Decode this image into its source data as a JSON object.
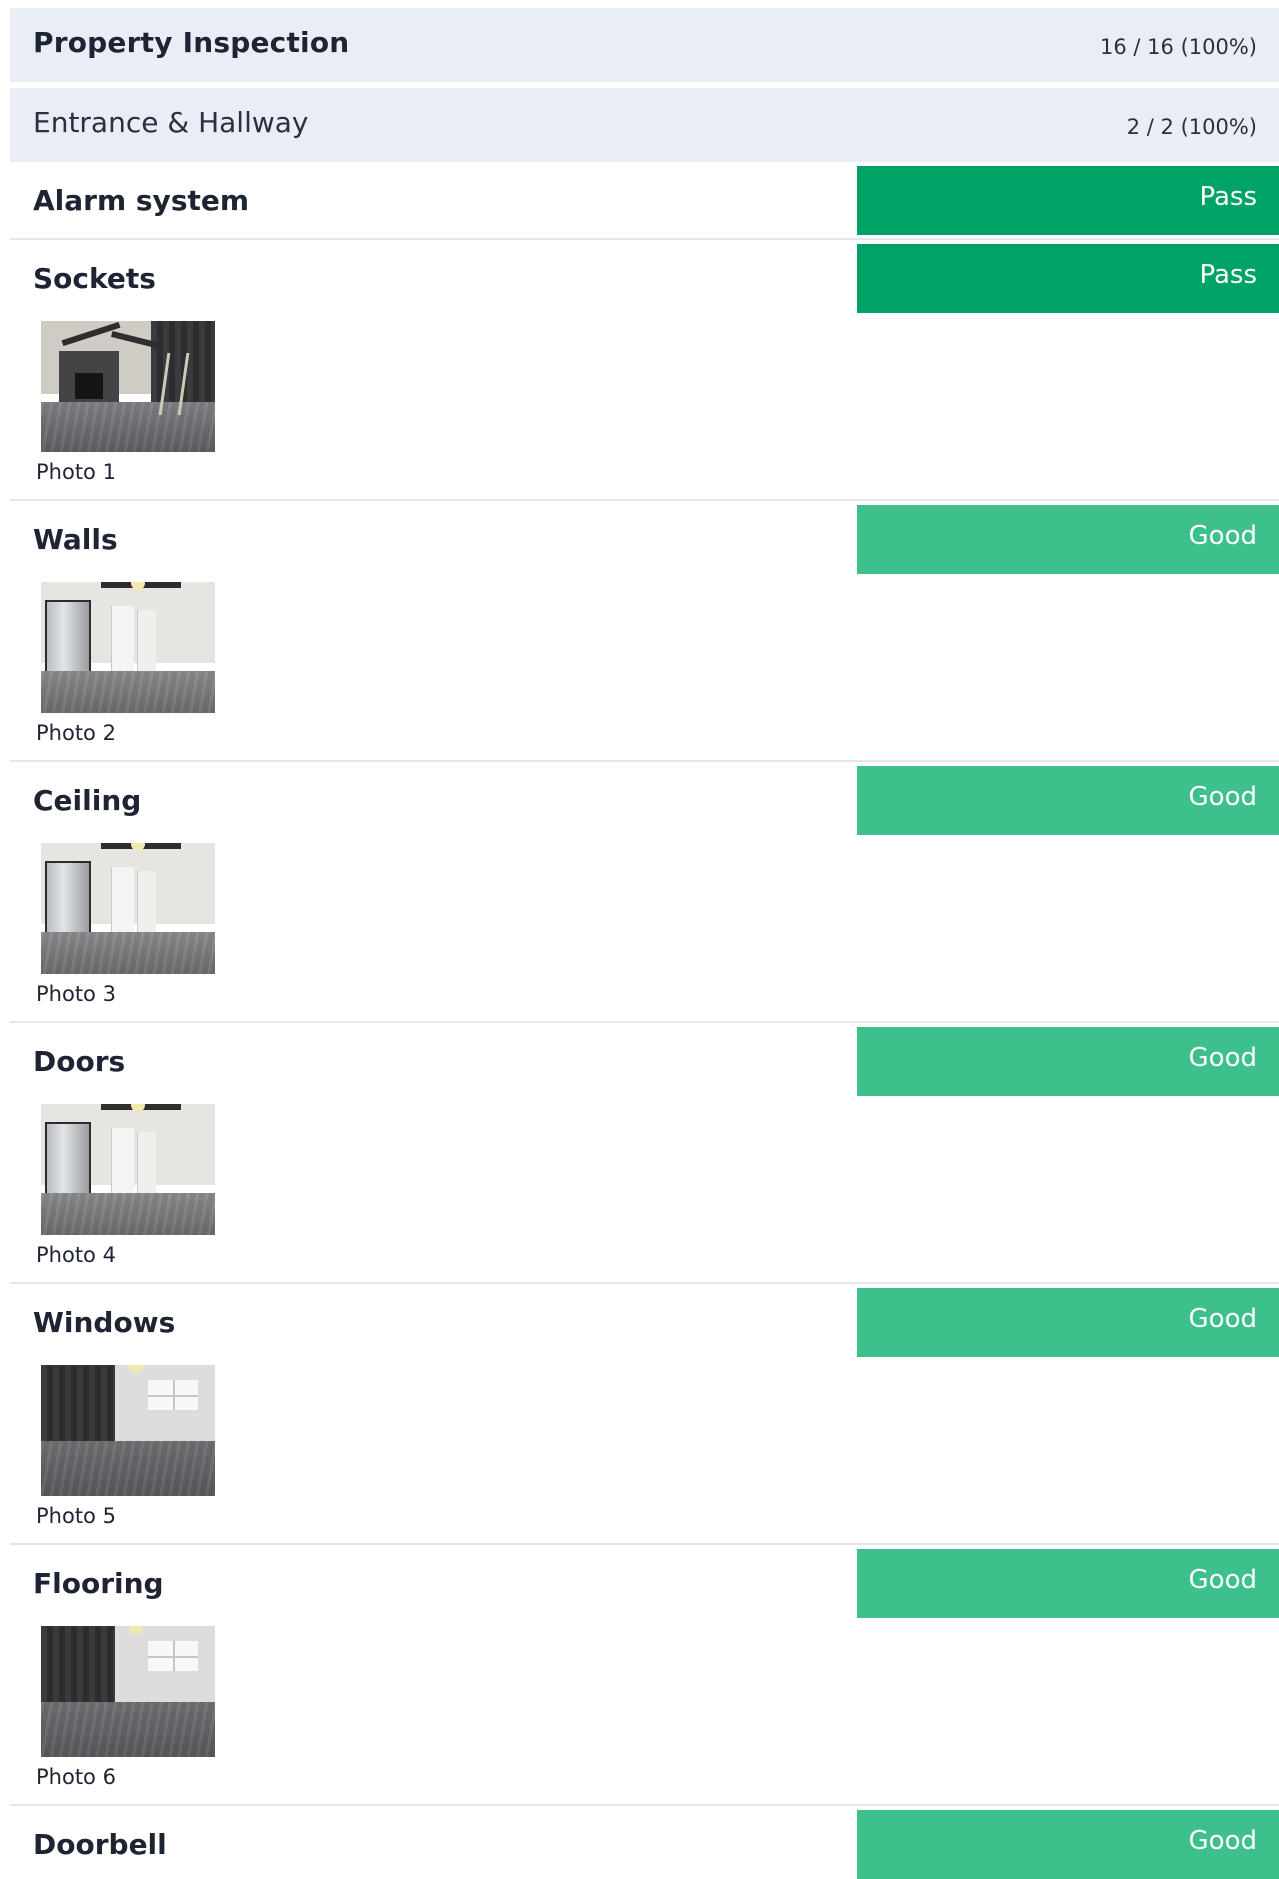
{
  "report": {
    "title": "Property Inspection",
    "count": "16 / 16 (100%)"
  },
  "section": {
    "title": "Entrance & Hallway",
    "count": "2 / 2 (100%)"
  },
  "items": [
    {
      "label": "Alarm system",
      "status": "Pass",
      "status_color": "#00a366"
    },
    {
      "label": "Sockets",
      "status": "Pass",
      "status_color": "#00a366",
      "photo": "Photo 1"
    },
    {
      "label": "Walls",
      "status": "Good",
      "status_color": "#3dc08b",
      "photo": "Photo 2"
    },
    {
      "label": "Ceiling",
      "status": "Good",
      "status_color": "#3dc08b",
      "photo": "Photo 3"
    },
    {
      "label": "Doors",
      "status": "Good",
      "status_color": "#3dc08b",
      "photo": "Photo 4"
    },
    {
      "label": "Windows",
      "status": "Good",
      "status_color": "#3dc08b",
      "photo": "Photo 5"
    },
    {
      "label": "Flooring",
      "status": "Good",
      "status_color": "#3dc08b",
      "photo": "Photo 6"
    },
    {
      "label": "Doorbell",
      "status": "Good",
      "status_color": "#3dc08b"
    }
  ],
  "colors": {
    "header_bg": "#e8edf6",
    "pass": "#00a366",
    "good": "#3dc08b",
    "divider": "#e3e6ec"
  }
}
